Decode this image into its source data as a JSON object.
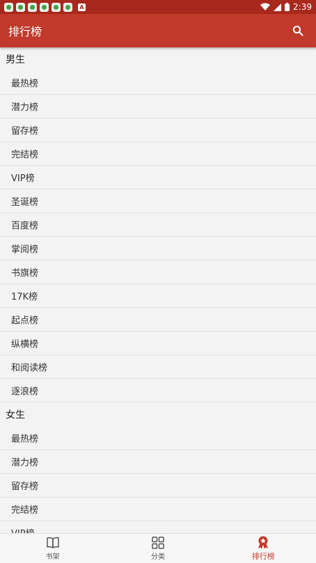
{
  "status_bar": {
    "time": "2:39",
    "notification_icons": [
      "app-icon",
      "app-icon",
      "app-icon",
      "app-icon",
      "app-icon",
      "app-icon"
    ],
    "a_badge": "A"
  },
  "app_bar": {
    "title": "排行榜",
    "search_icon": "search-icon"
  },
  "sections": [
    {
      "title": "男生",
      "items": [
        "最热榜",
        "潜力榜",
        "留存榜",
        "完结榜",
        "VIP榜",
        "圣诞榜",
        "百度榜",
        "掌阅榜",
        "书旗榜",
        "17K榜",
        "起点榜",
        "纵横榜",
        "和阅读榜",
        "逐浪榜"
      ]
    },
    {
      "title": "女生",
      "items": [
        "最热榜",
        "潜力榜",
        "留存榜",
        "完结榜",
        "VIP榜"
      ]
    }
  ],
  "bottom_nav": {
    "items": [
      {
        "label": "书架",
        "icon": "book-icon",
        "active": false
      },
      {
        "label": "分类",
        "icon": "grid-icon",
        "active": false
      },
      {
        "label": "排行榜",
        "icon": "award-icon",
        "active": true
      }
    ]
  },
  "colors": {
    "status_bar": "#a8281d",
    "app_bar": "#c0392b",
    "accent": "#c0392b"
  }
}
